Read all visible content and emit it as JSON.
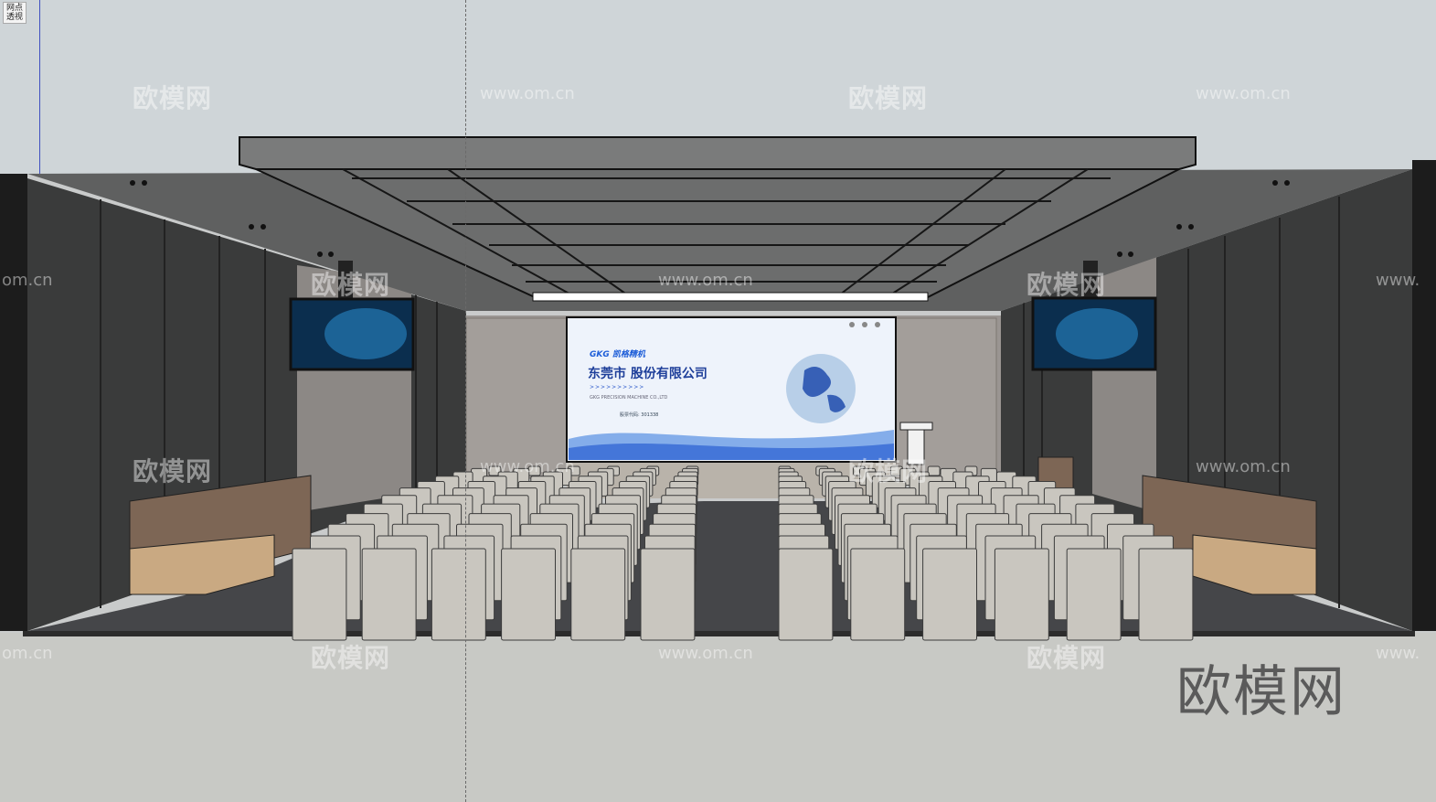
{
  "viewport": {
    "corner_label": "网点\n透视"
  },
  "watermarks": {
    "brand": "欧模网",
    "url": "www.om.cn",
    "url_partial_left": "om.cn",
    "url_partial_right": "www."
  },
  "logo": {
    "text": "欧模网"
  },
  "main_screen": {
    "brand": "GKG 凯格精机",
    "company": "东莞市        股份有限公司",
    "arrows": ">>>>>>>>>>",
    "subtitle": "GKG PRECISION MACHINE CO.,LTD",
    "footer": "股票代码: 301338"
  },
  "colors": {
    "wall_dark": "#3a3b3b",
    "ceiling": "#6b6c6c",
    "floor": "#444548",
    "chair": "#c9c6bf",
    "sofa": "#7d6655",
    "wood": "#c9a982"
  }
}
